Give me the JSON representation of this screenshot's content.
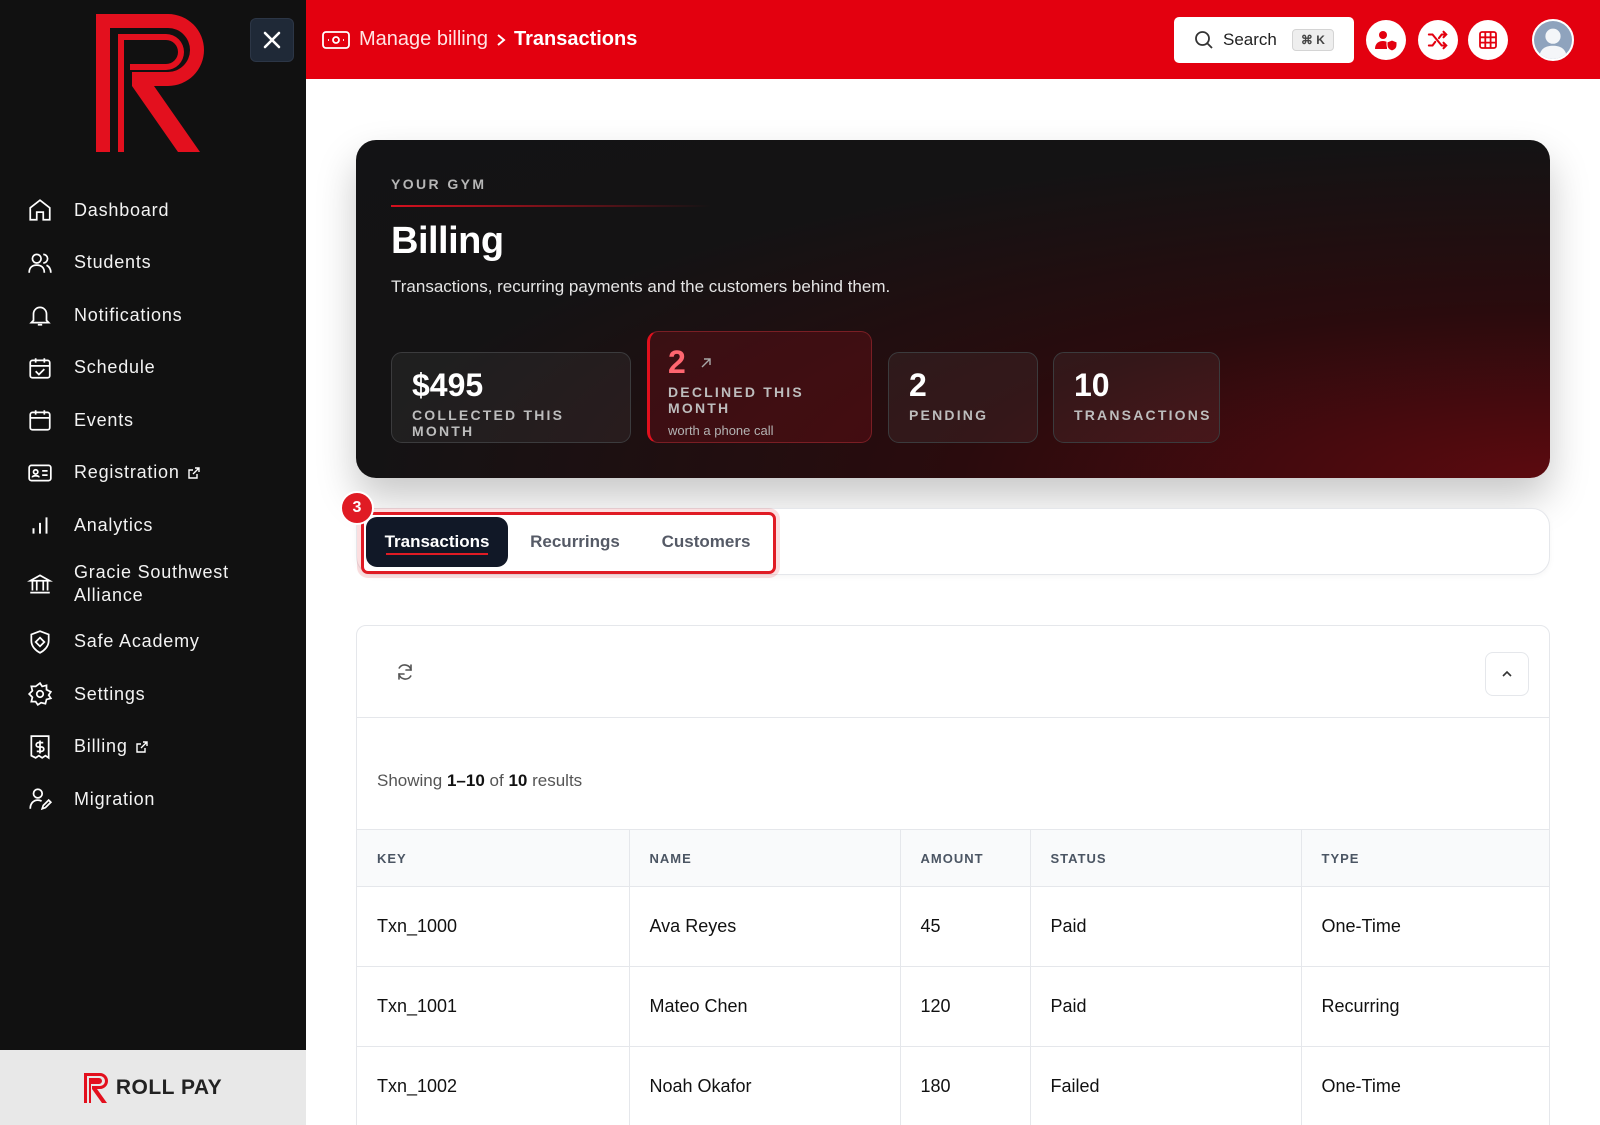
{
  "sidebar": {
    "brand_footer": "ROLL PAY",
    "items": [
      {
        "label": "Dashboard",
        "icon": "home-icon"
      },
      {
        "label": "Students",
        "icon": "users-icon"
      },
      {
        "label": "Notifications",
        "icon": "bell-icon"
      },
      {
        "label": "Schedule",
        "icon": "calendar-check-icon"
      },
      {
        "label": "Events",
        "icon": "calendar-icon"
      },
      {
        "label": "Registration",
        "icon": "id-card-icon",
        "external": true
      },
      {
        "label": "Analytics",
        "icon": "bar-chart-icon"
      },
      {
        "label": "Gracie Southwest Alliance",
        "icon": "bank-icon"
      },
      {
        "label": "Safe Academy",
        "icon": "shield-icon"
      },
      {
        "label": "Settings",
        "icon": "gear-icon"
      },
      {
        "label": "Billing",
        "icon": "dollar-doc-icon",
        "external": true
      },
      {
        "label": "Migration",
        "icon": "user-edit-icon"
      }
    ]
  },
  "header": {
    "breadcrumb_parent": "Manage billing",
    "breadcrumb_current": "Transactions",
    "search_label": "Search",
    "search_shortcut": "⌘ K",
    "accent": "#e3000f"
  },
  "hero": {
    "eyebrow": "YOUR GYM",
    "title": "Billing",
    "subtitle": "Transactions, recurring payments and the customers behind them.",
    "stats": {
      "collected": {
        "value": "$495",
        "label": "COLLECTED THIS MONTH"
      },
      "declined": {
        "value": "2",
        "label": "DECLINED THIS MONTH",
        "note": "worth a phone call"
      },
      "pending": {
        "value": "2",
        "label": "PENDING"
      },
      "transactions": {
        "value": "10",
        "label": "TRANSACTIONS"
      }
    }
  },
  "tabs": {
    "step": "3",
    "items": [
      "Transactions",
      "Recurrings",
      "Customers"
    ],
    "active": "Transactions"
  },
  "table": {
    "results_prefix": "Showing",
    "results_range": "1–10",
    "results_of": "of",
    "results_total": "10",
    "results_suffix": "results",
    "columns": [
      "KEY",
      "NAME",
      "AMOUNT",
      "STATUS",
      "TYPE"
    ],
    "rows": [
      [
        "Txn_1000",
        "Ava Reyes",
        "45",
        "Paid",
        "One-Time"
      ],
      [
        "Txn_1001",
        "Mateo Chen",
        "120",
        "Paid",
        "Recurring"
      ],
      [
        "Txn_1002",
        "Noah Okafor",
        "180",
        "Failed",
        "One-Time"
      ]
    ]
  }
}
